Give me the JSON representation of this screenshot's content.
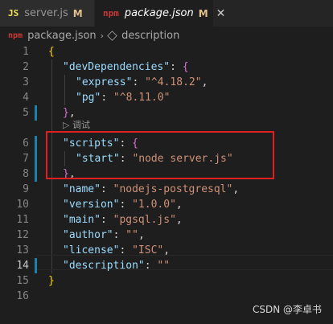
{
  "tabs": [
    {
      "icon": "JS",
      "name": "server.js",
      "status": "M",
      "close": ""
    },
    {
      "icon": "npm",
      "name": "package.json",
      "status": "M",
      "close": "✕"
    }
  ],
  "breadcrumb": {
    "icon": "npm",
    "file": "package.json",
    "separator": "›",
    "item": "description"
  },
  "codelens": "▷ 调试",
  "lines": [
    {
      "n": "1"
    },
    {
      "n": "2"
    },
    {
      "n": "3"
    },
    {
      "n": "4"
    },
    {
      "n": "5"
    },
    {
      "n": "6"
    },
    {
      "n": "7"
    },
    {
      "n": "8"
    },
    {
      "n": "9"
    },
    {
      "n": "10"
    },
    {
      "n": "11"
    },
    {
      "n": "12"
    },
    {
      "n": "13"
    },
    {
      "n": "14"
    },
    {
      "n": "15"
    },
    {
      "n": "16"
    }
  ],
  "code": {
    "l1_open": "{",
    "l2_key": "\"devDependencies\"",
    "l2_colon": ": ",
    "l2_open": "{",
    "l3_key": "\"express\"",
    "l3_colon": ": ",
    "l3_val": "\"^4.18.2\"",
    "l3_comma": ",",
    "l4_key": "\"pg\"",
    "l4_colon": ": ",
    "l4_val": "\"^8.11.0\"",
    "l5_close": "}",
    "l5_comma": ",",
    "l6_key": "\"scripts\"",
    "l6_colon": ": ",
    "l6_open": "{",
    "l7_key": "\"start\"",
    "l7_colon": ": ",
    "l7_val": "\"node server.js\"",
    "l8_close": "}",
    "l8_comma": ",",
    "l9_key": "\"name\"",
    "l9_colon": ": ",
    "l9_val": "\"nodejs-postgresql\"",
    "l9_comma": ",",
    "l10_key": "\"version\"",
    "l10_colon": ": ",
    "l10_val": "\"1.0.0\"",
    "l10_comma": ",",
    "l11_key": "\"main\"",
    "l11_colon": ": ",
    "l11_val": "\"pgsql.js\"",
    "l11_comma": ",",
    "l12_key": "\"author\"",
    "l12_colon": ": ",
    "l12_val": "\"\"",
    "l12_comma": ",",
    "l13_key": "\"license\"",
    "l13_colon": ": ",
    "l13_val": "\"ISC\"",
    "l13_comma": ",",
    "l14_key": "\"description\"",
    "l14_colon": ": ",
    "l14_val": "\"\"",
    "l15_close": "}"
  },
  "watermark": "CSDN @李卓书",
  "colors": {
    "background": "#1e1e1e",
    "key": "#9cdcfe",
    "string": "#ce9178",
    "brace_outer": "#ffd700",
    "brace_inner": "#da70d6",
    "highlight_box": "#e02020",
    "modified": "#e2c08d"
  }
}
